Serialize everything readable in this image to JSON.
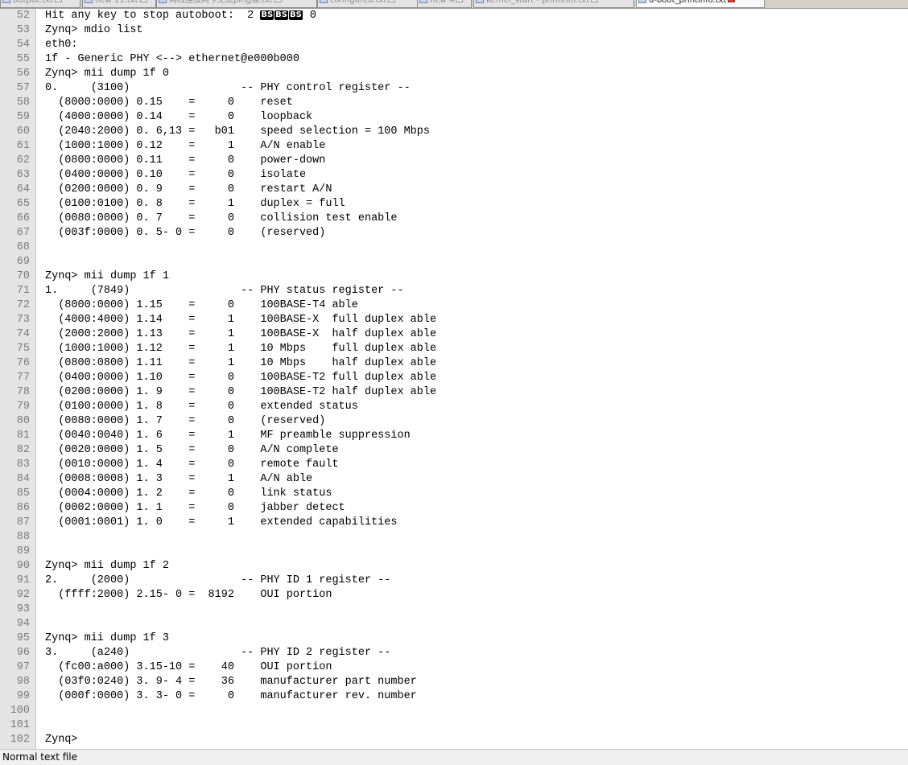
{
  "tabs": [
    {
      "label": "output.txt",
      "active": false
    },
    {
      "label": "new 11.txt",
      "active": false
    },
    {
      "label": "网线连接网卡无法ping通.txt",
      "active": false
    },
    {
      "label": "configured.txt",
      "active": false
    },
    {
      "label": "new 4",
      "active": false
    },
    {
      "label": "kernel_start - printinfo.txt",
      "active": false
    },
    {
      "label": "u-boot_printinfo.txt",
      "active": true
    }
  ],
  "editor": {
    "lines": [
      {
        "num": "52",
        "segments": [
          {
            "t": "Hit any key to stop autoboot:  2 "
          },
          {
            "t": "BS",
            "bs": true
          },
          {
            "t": "BS",
            "bs": true
          },
          {
            "t": "BS",
            "bs": true
          },
          {
            "t": " 0"
          }
        ]
      },
      {
        "num": "53",
        "segments": [
          {
            "t": "Zynq> mdio list"
          }
        ]
      },
      {
        "num": "54",
        "segments": [
          {
            "t": "eth0:"
          }
        ]
      },
      {
        "num": "55",
        "segments": [
          {
            "t": "1f - Generic PHY <--> ethernet@e000b000"
          }
        ]
      },
      {
        "num": "56",
        "segments": [
          {
            "t": "Zynq> mii dump 1f 0"
          }
        ]
      },
      {
        "num": "57",
        "segments": [
          {
            "t": "0.     (3100)                 -- PHY control register --"
          }
        ]
      },
      {
        "num": "58",
        "segments": [
          {
            "t": "  (8000:0000) 0.15    =     0    reset"
          }
        ]
      },
      {
        "num": "59",
        "segments": [
          {
            "t": "  (4000:0000) 0.14    =     0    loopback"
          }
        ]
      },
      {
        "num": "60",
        "segments": [
          {
            "t": "  (2040:2000) 0. 6,13 =   b01    speed selection = 100 Mbps"
          }
        ]
      },
      {
        "num": "61",
        "segments": [
          {
            "t": "  (1000:1000) 0.12    =     1    A/N enable"
          }
        ]
      },
      {
        "num": "62",
        "segments": [
          {
            "t": "  (0800:0000) 0.11    =     0    power-down"
          }
        ]
      },
      {
        "num": "63",
        "segments": [
          {
            "t": "  (0400:0000) 0.10    =     0    isolate"
          }
        ]
      },
      {
        "num": "64",
        "segments": [
          {
            "t": "  (0200:0000) 0. 9    =     0    restart A/N"
          }
        ]
      },
      {
        "num": "65",
        "segments": [
          {
            "t": "  (0100:0100) 0. 8    =     1    duplex = full"
          }
        ]
      },
      {
        "num": "66",
        "segments": [
          {
            "t": "  (0080:0000) 0. 7    =     0    collision test enable"
          }
        ]
      },
      {
        "num": "67",
        "segments": [
          {
            "t": "  (003f:0000) 0. 5- 0 =     0    (reserved)"
          }
        ]
      },
      {
        "num": "68",
        "segments": [
          {
            "t": ""
          }
        ]
      },
      {
        "num": "69",
        "segments": [
          {
            "t": ""
          }
        ]
      },
      {
        "num": "70",
        "segments": [
          {
            "t": "Zynq> mii dump 1f 1"
          }
        ]
      },
      {
        "num": "71",
        "segments": [
          {
            "t": "1.     (7849)                 -- PHY status register --"
          }
        ]
      },
      {
        "num": "72",
        "segments": [
          {
            "t": "  (8000:0000) 1.15    =     0    100BASE-T4 able"
          }
        ]
      },
      {
        "num": "73",
        "segments": [
          {
            "t": "  (4000:4000) 1.14    =     1    100BASE-X  full duplex able"
          }
        ]
      },
      {
        "num": "74",
        "segments": [
          {
            "t": "  (2000:2000) 1.13    =     1    100BASE-X  half duplex able"
          }
        ]
      },
      {
        "num": "75",
        "segments": [
          {
            "t": "  (1000:1000) 1.12    =     1    10 Mbps    full duplex able"
          }
        ]
      },
      {
        "num": "76",
        "segments": [
          {
            "t": "  (0800:0800) 1.11    =     1    10 Mbps    half duplex able"
          }
        ]
      },
      {
        "num": "77",
        "segments": [
          {
            "t": "  (0400:0000) 1.10    =     0    100BASE-T2 full duplex able"
          }
        ]
      },
      {
        "num": "78",
        "segments": [
          {
            "t": "  (0200:0000) 1. 9    =     0    100BASE-T2 half duplex able"
          }
        ]
      },
      {
        "num": "79",
        "segments": [
          {
            "t": "  (0100:0000) 1. 8    =     0    extended status"
          }
        ]
      },
      {
        "num": "80",
        "segments": [
          {
            "t": "  (0080:0000) 1. 7    =     0    (reserved)"
          }
        ]
      },
      {
        "num": "81",
        "segments": [
          {
            "t": "  (0040:0040) 1. 6    =     1    MF preamble suppression"
          }
        ]
      },
      {
        "num": "82",
        "segments": [
          {
            "t": "  (0020:0000) 1. 5    =     0    A/N complete"
          }
        ]
      },
      {
        "num": "83",
        "segments": [
          {
            "t": "  (0010:0000) 1. 4    =     0    remote fault"
          }
        ]
      },
      {
        "num": "84",
        "segments": [
          {
            "t": "  (0008:0008) 1. 3    =     1    A/N able"
          }
        ]
      },
      {
        "num": "85",
        "segments": [
          {
            "t": "  (0004:0000) 1. 2    =     0    link status"
          }
        ]
      },
      {
        "num": "86",
        "segments": [
          {
            "t": "  (0002:0000) 1. 1    =     0    jabber detect"
          }
        ]
      },
      {
        "num": "87",
        "segments": [
          {
            "t": "  (0001:0001) 1. 0    =     1    extended capabilities"
          }
        ]
      },
      {
        "num": "88",
        "segments": [
          {
            "t": ""
          }
        ]
      },
      {
        "num": "89",
        "segments": [
          {
            "t": ""
          }
        ]
      },
      {
        "num": "90",
        "segments": [
          {
            "t": "Zynq> mii dump 1f 2"
          }
        ]
      },
      {
        "num": "91",
        "segments": [
          {
            "t": "2.     (2000)                 -- PHY ID 1 register --"
          }
        ]
      },
      {
        "num": "92",
        "segments": [
          {
            "t": "  (ffff:2000) 2.15- 0 =  8192    OUI portion"
          }
        ]
      },
      {
        "num": "93",
        "segments": [
          {
            "t": ""
          }
        ]
      },
      {
        "num": "94",
        "segments": [
          {
            "t": ""
          }
        ]
      },
      {
        "num": "95",
        "segments": [
          {
            "t": "Zynq> mii dump 1f 3"
          }
        ]
      },
      {
        "num": "96",
        "segments": [
          {
            "t": "3.     (a240)                 -- PHY ID 2 register --"
          }
        ]
      },
      {
        "num": "97",
        "segments": [
          {
            "t": "  (fc00:a000) 3.15-10 =    40    OUI portion"
          }
        ]
      },
      {
        "num": "98",
        "segments": [
          {
            "t": "  (03f0:0240) 3. 9- 4 =    36    manufacturer part number"
          }
        ]
      },
      {
        "num": "99",
        "segments": [
          {
            "t": "  (000f:0000) 3. 3- 0 =     0    manufacturer rev. number"
          }
        ]
      },
      {
        "num": "100",
        "segments": [
          {
            "t": ""
          }
        ]
      },
      {
        "num": "101",
        "segments": [
          {
            "t": ""
          }
        ]
      },
      {
        "num": "102",
        "segments": [
          {
            "t": "Zynq>"
          }
        ]
      }
    ]
  },
  "statusbar": {
    "text": "Normal text file"
  }
}
